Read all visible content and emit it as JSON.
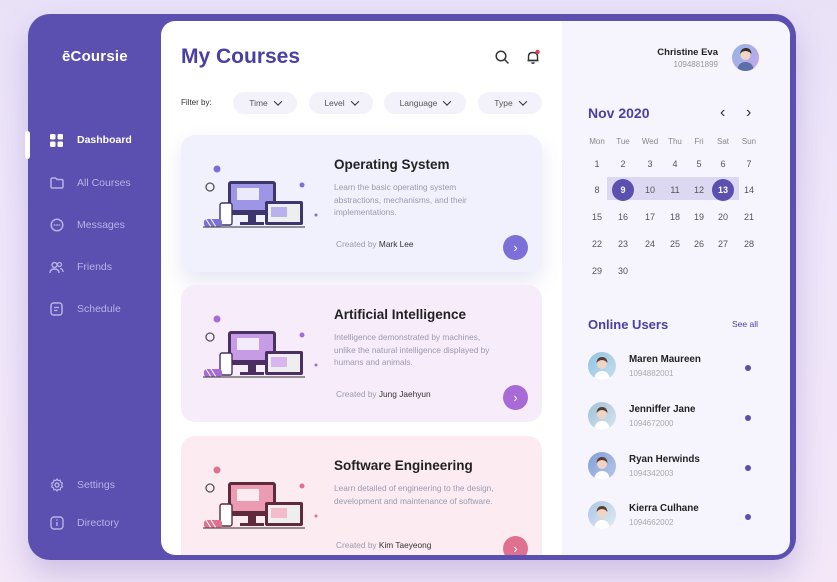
{
  "app": {
    "logo": "ēCoursie"
  },
  "sidebar": {
    "items": [
      {
        "label": "Dashboard",
        "icon": "dashboard-grid-icon"
      },
      {
        "label": "All Courses",
        "icon": "folder-icon"
      },
      {
        "label": "Messages",
        "icon": "chat-icon"
      },
      {
        "label": "Friends",
        "icon": "users-icon"
      },
      {
        "label": "Schedule",
        "icon": "calendar-icon"
      }
    ],
    "bottom": [
      {
        "label": "Settings",
        "icon": "gear-icon"
      },
      {
        "label": "Directory",
        "icon": "info-icon"
      }
    ]
  },
  "main": {
    "title": "My Courses",
    "filter_label": "Filter by:",
    "filters": [
      "Time",
      "Level",
      "Language",
      "Type"
    ],
    "courses": [
      {
        "title": "Operating System",
        "desc": "Learn the basic operating system abstractions, mechanisms, and their implementations.",
        "by_label": "Created by",
        "author": "Mark Lee",
        "accent": "#7b6fd8"
      },
      {
        "title": "Artificial Intelligence",
        "desc": "Intelligence demonstrated by machines, unlike the natural intelligence displayed by humans and animals.",
        "by_label": "Created by",
        "author": "Jung Jaehyun",
        "accent": "#a86ad6"
      },
      {
        "title": "Software Engineering",
        "desc": "Learn detailed of engineering to the design, development and maintenance of software.",
        "by_label": "Created by",
        "author": "Kim Taeyeong",
        "accent": "#e0708f"
      }
    ]
  },
  "user": {
    "name": "Christine Eva",
    "id": "1094881899"
  },
  "calendar": {
    "month": "Nov 2020",
    "prev": "‹",
    "next": "›",
    "dow": [
      "Mon",
      "Tue",
      "Wed",
      "Thu",
      "Fri",
      "Sat",
      "Sun"
    ],
    "weeks": [
      [
        "1",
        "2",
        "3",
        "4",
        "5",
        "6",
        "7"
      ],
      [
        "8",
        "9",
        "10",
        "11",
        "12",
        "13",
        "14"
      ],
      [
        "15",
        "16",
        "17",
        "18",
        "19",
        "20",
        "21"
      ],
      [
        "22",
        "23",
        "24",
        "25",
        "26",
        "27",
        "28"
      ],
      [
        "29",
        "30"
      ]
    ],
    "selected_start": "9",
    "selected_end": "13"
  },
  "online": {
    "title": "Online Users",
    "see_all": "See all",
    "users": [
      {
        "name": "Maren Maureen",
        "id": "1094882001"
      },
      {
        "name": "Jenniffer Jane",
        "id": "1094672000"
      },
      {
        "name": "Ryan Herwinds",
        "id": "1094342003"
      },
      {
        "name": "Kierra Culhane",
        "id": "1094662002"
      }
    ]
  }
}
